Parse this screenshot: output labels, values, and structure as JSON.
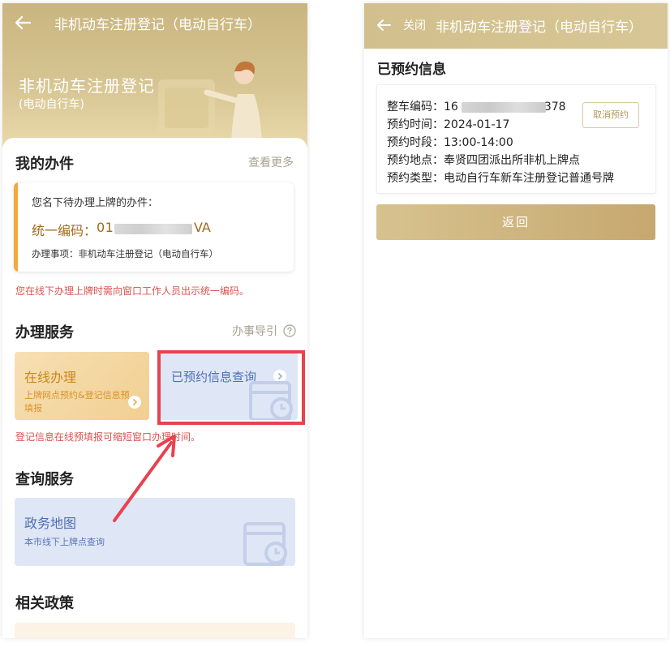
{
  "left": {
    "header": {
      "title": "非机动车注册登记（电动自行车）"
    },
    "hero": {
      "title": "非机动车注册登记",
      "subtitle": "(电动自行车)"
    },
    "my_tasks": {
      "title": "我的办件",
      "more": "查看更多",
      "card": {
        "label": "您名下待办理上牌的办件：",
        "code_label": "统一编码：",
        "code_prefix": "01",
        "code_suffix": "VA",
        "item": "办理事项：非机动车注册登记（电动自行车）"
      },
      "note": "您在线下办理上牌时需向窗口工作人员出示统一编码。"
    },
    "services": {
      "title": "办理服务",
      "guide": "办事导引",
      "online": {
        "title": "在线办理",
        "desc": "上牌网点预约&登记信息预填报"
      },
      "query": {
        "title": "已预约信息查询"
      },
      "note": "登记信息在线预填报可缩短窗口办理时间。"
    },
    "query_services": {
      "title": "查询服务",
      "map": {
        "title": "政务地图",
        "desc": "本市线下上牌点查询"
      }
    },
    "policy": {
      "title": "相关政策"
    }
  },
  "right": {
    "header": {
      "close": "关闭",
      "title": "非机动车注册登记（电动自行车）"
    },
    "heading": "已预约信息",
    "info": {
      "vehicle_code_label": "整车编码：",
      "vehicle_code_prefix": "16",
      "vehicle_code_suffix": "378",
      "date_label": "预约时间：",
      "date": "2024-01-17",
      "slot_label": "预约时段：",
      "slot": "13:00-14:00",
      "place_label": "预约地点：",
      "place": "奉贤四团派出所非机上牌点",
      "type_label": "预约类型：",
      "type": "电动自行车新车注册登记普通号牌"
    },
    "cancel": "取消预约",
    "return": "返回"
  },
  "colors": {
    "gold": "#c9b57f",
    "accent_orange": "#f3a93b",
    "highlight_red": "#e8424f",
    "note_red": "#d9534f",
    "tile_blue": "#dfe6f5"
  }
}
